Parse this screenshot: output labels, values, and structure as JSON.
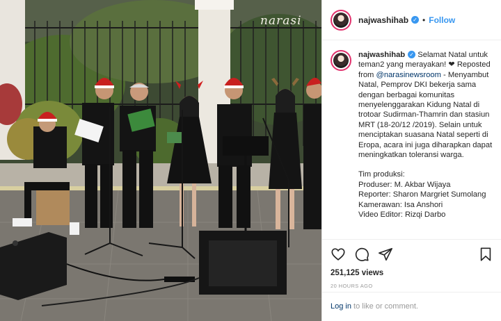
{
  "media": {
    "watermark": "narasi"
  },
  "post": {
    "username": "najwashihab",
    "verified_icon": "verified-badge-icon",
    "separator": "•",
    "follow_label": "Follow"
  },
  "caption": {
    "username": "najwashihab",
    "text_1": " Selamat Natal untuk teman2 yang merayakan! ❤",
    "text_2": " Reposted from ",
    "mention": "@narasinewsroom",
    "text_3": " - Menyambut Natal, Pemprov DKI bekerja sama dengan berbagai komunitas menyelenggarakan Kidung Natal di trotoar Sudirman-Thamrin dan stasiun MRT (18-20/12 /2019). Selain untuk menciptakan suasana Natal seperti di Eropa, acara ini juga diharapkan dapat meningkatkan toleransi warga.",
    "credits_title": "Tim produksi:",
    "credit_1": "Produser: M. Akbar Wijaya",
    "credit_2": "Reporter: Sharon Margriet Sumolang",
    "credit_3": "Kamerawan: Isa Anshori",
    "credit_4": "Video Editor: Rizqi Darbo"
  },
  "actions": {
    "like_icon": "heart-icon",
    "comment_icon": "comment-icon",
    "share_icon": "paper-plane-icon",
    "save_icon": "bookmark-icon"
  },
  "stats": {
    "views": "251,125 views",
    "time": "20 HOURS AGO"
  },
  "footer": {
    "login_link": "Log in",
    "login_rest": " to like or comment."
  }
}
